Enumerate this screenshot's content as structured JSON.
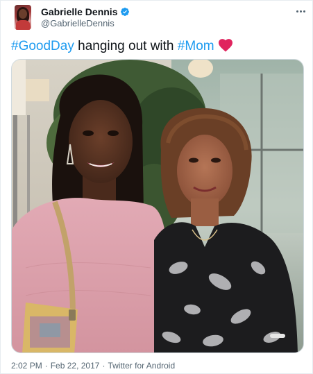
{
  "author": {
    "display_name": "Gabrielle Dennis",
    "handle": "@GabrielleDennis",
    "verified": true,
    "verified_icon_color": "#1d9bf0"
  },
  "tweet": {
    "hashtag_1": "#GoodDay",
    "text_mid": " hanging out with ",
    "hashtag_2": "#Mom",
    "emoji": "red-heart",
    "hashtag_color": "#1d9bf0",
    "heart_color": "#e0245e"
  },
  "meta": {
    "time": "2:02 PM",
    "sep1": "·",
    "date": "Feb 22, 2017",
    "sep2": "·",
    "source": "Twitter for Android"
  },
  "icons": {
    "more": "more-horizontal-icon",
    "verified": "verified-badge-icon"
  }
}
